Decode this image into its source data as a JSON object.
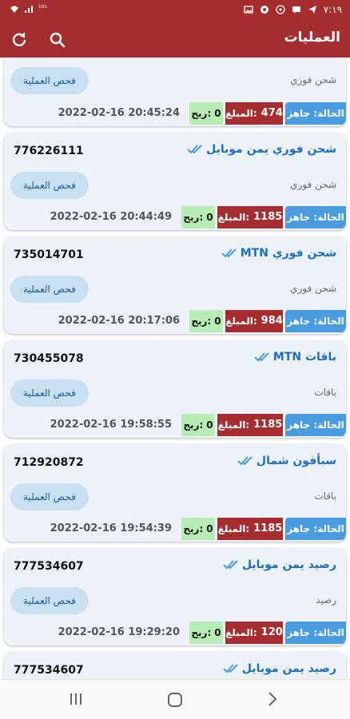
{
  "status_bar": {
    "time": "٧:١٩",
    "left_text": "¹⁰¹"
  },
  "app_bar": {
    "title": "العمليات"
  },
  "labels": {
    "status_label": "الحالة: جاهز",
    "amount_label": "المبلغ:",
    "profit_label": "ربح:",
    "check_button": "فحص العملية"
  },
  "transactions": [
    {
      "title": "",
      "phone": "",
      "subtitle": "شحن فوري",
      "amount": "474",
      "profit": "0",
      "datetime": "2022-02-16 20:45:24"
    },
    {
      "title": "شحن فوري يمن موبايل",
      "phone": "776226111",
      "subtitle": "شحن فوري",
      "amount": "1185",
      "profit": "0",
      "datetime": "2022-02-16 20:44:49"
    },
    {
      "title": "شحن فوري MTN",
      "phone": "735014701",
      "subtitle": "شحن فوري",
      "amount": "984",
      "profit": "0",
      "datetime": "2022-02-16 20:17:06"
    },
    {
      "title": "باقات MTN",
      "phone": "730455078",
      "subtitle": "باقات",
      "amount": "1185",
      "profit": "0",
      "datetime": "2022-02-16 19:58:55"
    },
    {
      "title": "سبأفون شمال",
      "phone": "712920872",
      "subtitle": "باقات",
      "amount": "1185",
      "profit": "0",
      "datetime": "2022-02-16 19:54:39"
    },
    {
      "title": "رصيد يمن موبايل",
      "phone": "777534607",
      "subtitle": "رصيد",
      "amount": "120",
      "profit": "0",
      "datetime": "2022-02-16 19:29:20"
    },
    {
      "title": "رصيد يمن موبايل",
      "phone": "777534607",
      "subtitle": "",
      "amount": "",
      "profit": "",
      "datetime": ""
    }
  ],
  "colors": {
    "primary": "#a52d2f",
    "status_blue": "#4a9ce0",
    "title_blue": "#1a6fc4",
    "profit_green": "#b7edb5",
    "card_bg": "#ecf2f8",
    "button_bg": "#c9e0f3"
  },
  "icons": {
    "refresh": "refresh-icon",
    "search": "search-icon",
    "check": "double-check-icon"
  }
}
